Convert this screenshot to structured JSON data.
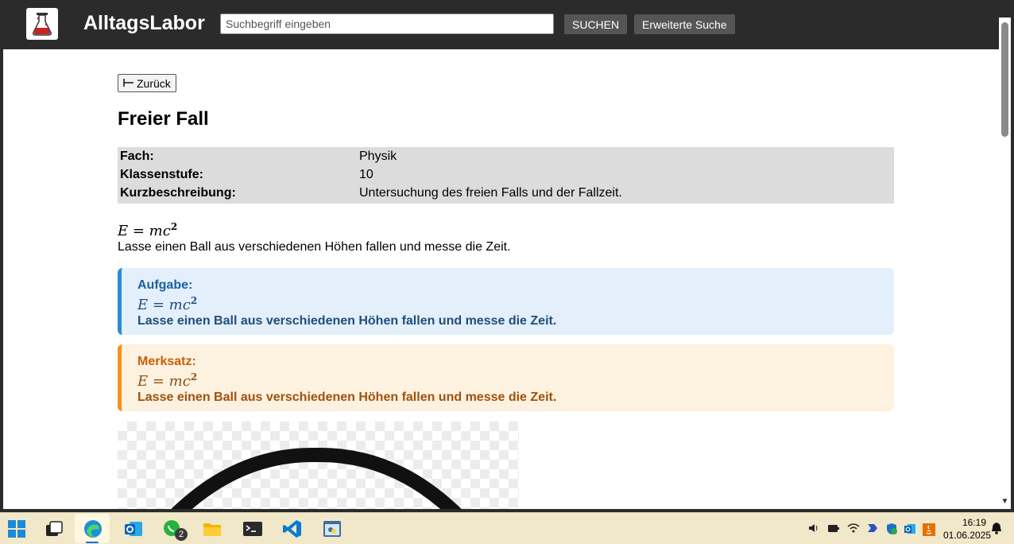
{
  "header": {
    "brand": "AlltagsLabor",
    "search_placeholder": "Suchbegriff eingeben",
    "search_button": "SUCHEN",
    "advanced_button": "Erweiterte Suche",
    "logo_icon": "flask-icon"
  },
  "page": {
    "back_label": "Zurück",
    "back_icon": "arrow-left-icon",
    "title": "Freier Fall",
    "info": [
      {
        "label": "Fach:",
        "value": "Physik"
      },
      {
        "label": "Klassenstufe:",
        "value": "10"
      },
      {
        "label": "Kurzbeschreibung:",
        "value": "Untersuchung des freien Falls und der Fallzeit."
      }
    ],
    "formula": "E = mc",
    "formula_exponent": "2",
    "description": "Lasse einen Ball aus verschiedenen Höhen fallen und messe die Zeit.",
    "aufgabe": {
      "heading": "Aufgabe:",
      "formula": "E = mc",
      "exponent": "2",
      "text": "Lasse einen Ball aus verschiedenen Höhen fallen und messe die Zeit."
    },
    "merksatz": {
      "heading": "Merksatz:",
      "formula": "E = mc",
      "exponent": "2",
      "text": "Lasse einen Ball aus verschiedenen Höhen fallen und messe die Zeit."
    }
  },
  "taskbar": {
    "apps": [
      "windows-start-icon",
      "task-view-icon",
      "edge-icon",
      "outlook-icon",
      "whatsapp-icon",
      "file-explorer-icon",
      "terminal-icon",
      "vscode-icon",
      "python-idle-icon"
    ],
    "whatsapp_badge": "2",
    "time": "16:19",
    "date": "01.06.2025"
  },
  "colors": {
    "topbar": "#2b2b2b",
    "info_bg": "#dcdcdc",
    "aufgabe_accent": "#2c8bd8",
    "merksatz_accent": "#f39318"
  }
}
